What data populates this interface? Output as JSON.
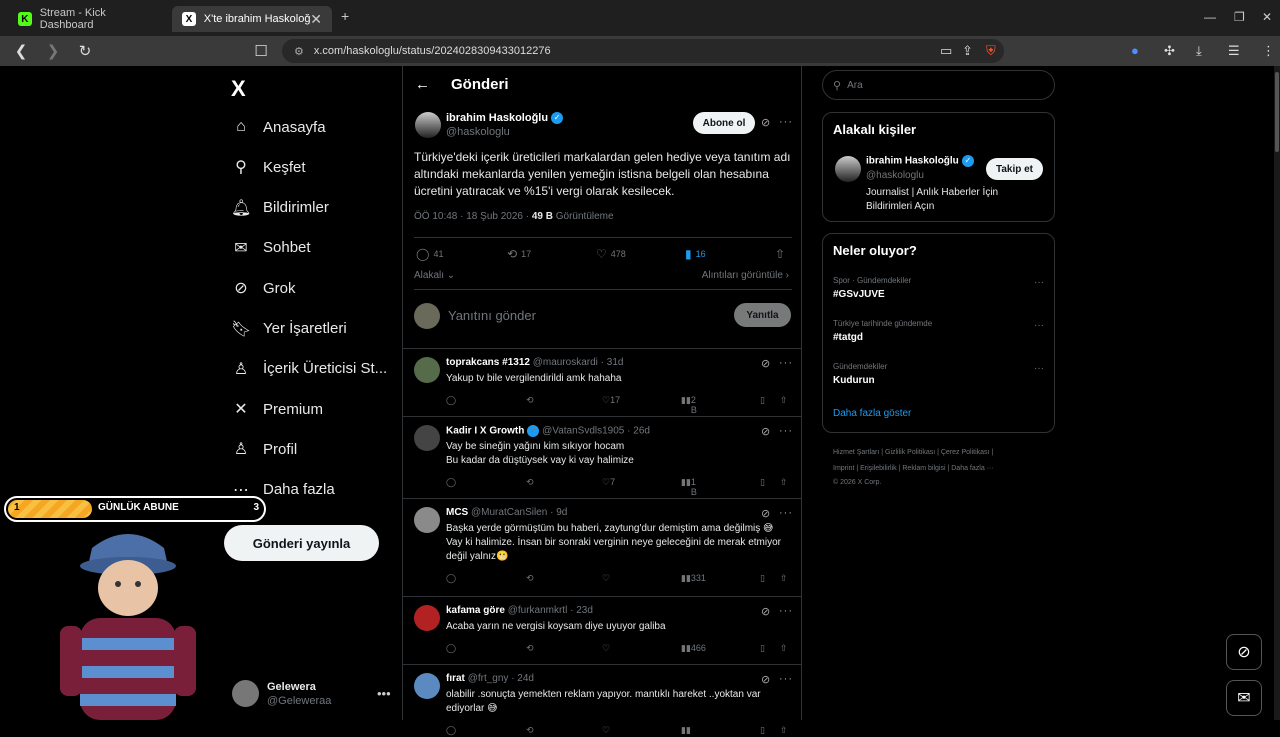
{
  "browser": {
    "tabs": [
      {
        "title": "Stream - Kick Dashboard",
        "favicon": "K"
      },
      {
        "title": "X'te ibrahim Haskoloğlu: \"Tür",
        "favicon": "X"
      }
    ],
    "new_tab": "+",
    "url": "x.com/haskologlu/status/2024028309433012276"
  },
  "nav": {
    "logo": "X",
    "items": [
      {
        "label": "Anasayfa",
        "icon": "home-icon",
        "glyph": "⌂"
      },
      {
        "label": "Keşfet",
        "icon": "search-icon",
        "glyph": "⚲"
      },
      {
        "label": "Bildirimler",
        "icon": "bell-icon",
        "glyph": "🔔︎"
      },
      {
        "label": "Sohbet",
        "icon": "mail-icon",
        "glyph": "✉"
      },
      {
        "label": "Grok",
        "icon": "grok-icon",
        "glyph": "⊘"
      },
      {
        "label": "Yer İşaretleri",
        "icon": "bookmark-icon",
        "glyph": "🔖︎"
      },
      {
        "label": "İçerik Üreticisi St...",
        "icon": "creator-icon",
        "glyph": "♙"
      },
      {
        "label": "Premium",
        "icon": "x-premium-icon",
        "glyph": "✕"
      },
      {
        "label": "Profil",
        "icon": "profile-icon",
        "glyph": "♙"
      },
      {
        "label": "Daha fazla",
        "icon": "more-circle-icon",
        "glyph": "⋯"
      }
    ],
    "post_button": "Gönderi yayınla",
    "account": {
      "name": "Gelewera",
      "handle": "@Geleweraa"
    }
  },
  "overlay": {
    "goal_current": "1",
    "goal_label": "GÜNLÜK ABUNE",
    "goal_target": "3",
    "goal_progress": 0.33
  },
  "post": {
    "header": "Gönderi",
    "author": "ibrahim Haskoloğlu",
    "handle": "@haskologlu",
    "subscribe": "Abone ol",
    "text": "Türkiye'deki içerik üreticileri markalardan gelen hediye veya tanıtım adı altındaki mekanlarda yenilen yemeğin istisna belgeli olan hesabına ücretini yatıracak ve %15'i vergi olarak kesilecek.",
    "time": "ÖÖ 10:48 · 18 Şub 2026 ·",
    "views_count": "49 B",
    "views_label": "Görüntüleme",
    "replies": "41",
    "reposts": "17",
    "likes": "478",
    "bookmarks": "16",
    "sort": "Alakalı",
    "quotes": "Alıntıları görüntüle",
    "reply_placeholder": "Yanıtını gönder",
    "reply_button": "Yanıtla"
  },
  "replies": [
    {
      "name": "toprakcans #1312",
      "handle": "@mauroskardi · 31d",
      "text": "Yakup tv bile vergilendirildi amk hahaha",
      "likes": "17",
      "views": "2 B",
      "avatar_color": "#556b4a",
      "verified": false
    },
    {
      "name": "Kadir I X Growth",
      "handle": "@VatanSvdls1905 · 26d",
      "text": "Vay be sineğin yağını kim sıkıyor hocam\nBu kadar da düştüysek vay ki vay halimize",
      "likes": "7",
      "views": "1 B",
      "avatar_color": "#444444",
      "verified": true
    },
    {
      "name": "MCS",
      "handle": "@MuratCanSilen · 9d",
      "text": "Başka yerde görmüştüm bu haberi, zaytung'dur demiştim ama değilmiş 😅\nVay ki halimize. İnsan bir sonraki verginin neye geleceğini de merak etmiyor değil yalnız😬",
      "likes": "",
      "views": "331",
      "avatar_color": "#8a8a8a",
      "verified": false
    },
    {
      "name": "kafama göre",
      "handle": "@furkanmkrtl · 23d",
      "text": "Acaba yarın ne vergisi koysam diye uyuyor galiba",
      "likes": "",
      "views": "466",
      "avatar_color": "#b22222",
      "verified": false
    },
    {
      "name": "fırat",
      "handle": "@frt_gny · 24d",
      "text": "olabilir .sonuçta yemekten reklam yapıyor. mantıklı hareket ..yoktan var ediyorlar 😅",
      "likes": "",
      "views": "",
      "avatar_color": "#5a8ac0",
      "verified": false
    }
  ],
  "sidebar": {
    "search_placeholder": "Ara",
    "related_title": "Alakalı kişiler",
    "related": {
      "name": "ibrahim Haskoloğlu",
      "handle": "@haskologlu",
      "follow": "Takip et",
      "bio": "Journalist | Anlık Haberler İçin Bildirimleri Açın"
    },
    "trends_title": "Neler oluyor?",
    "trends": [
      {
        "context": "Spor · Gündemdekiler",
        "name": "#GSvJUVE"
      },
      {
        "context": "Türkiye tarihinde gündemde",
        "name": "#tatgd"
      },
      {
        "context": "Gündemdekiler",
        "name": "Kudurun"
      }
    ],
    "show_more": "Daha fazla göster",
    "footer_line1": "Hizmet Şartları  |  Gizlilik Politikası  |  Çerez Politikası  |",
    "footer_line2": "Imprint  |  Erişilebilirlik  |  Reklam bilgisi  |  Daha fazla ···",
    "footer_line3": "© 2026 X Corp."
  },
  "colors": {
    "accent": "#1d9bf0",
    "background": "#000000",
    "border": "#2f3336",
    "muted": "#71767b"
  }
}
